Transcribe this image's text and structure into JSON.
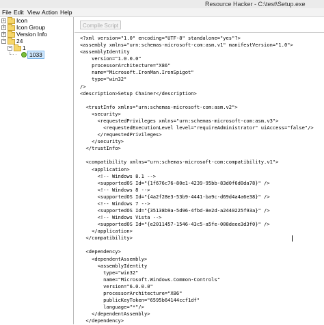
{
  "window": {
    "title": "Resource Hacker  -  C:\\test\\Setup.exe"
  },
  "menu": [
    "File",
    "Edit",
    "View",
    "Action",
    "Help"
  ],
  "tree": {
    "items": [
      {
        "label": "Icon",
        "expander": "+"
      },
      {
        "label": "Icon Group",
        "expander": "+"
      },
      {
        "label": "Version Info",
        "expander": "+"
      },
      {
        "label": "24",
        "expander": "−"
      },
      {
        "label": "1",
        "expander": "−"
      },
      {
        "label": "1033",
        "expander": ""
      }
    ]
  },
  "toolbar": {
    "compile_label": "Compile Script"
  },
  "editor": {
    "lines": [
      "<?xml version=\"1.0\" encoding=\"UTF-8\" standalone=\"yes\"?>",
      "<assembly xmlns=\"urn:schemas-microsoft-com:asm.v1\" manifestVersion=\"1.0\">",
      "<assemblyIdentity",
      "    version=\"1.0.0.0\"",
      "    processorArchitecture=\"X86\"",
      "    name=\"Microsoft.IronMan.IronSpigot\"",
      "    type=\"win32\"",
      "/>",
      "<description>Setup Chainer</description>",
      "",
      "  <trustInfo xmlns=\"urn:schemas-microsoft-com:asm.v2\">",
      "    <security>",
      "      <requestedPrivileges xmlns=\"urn:schemas-microsoft-com:asm.v3\">",
      "        <requestedExecutionLevel level=\"requireAdministrator\" uiAccess=\"false\"/>",
      "      </requestedPrivileges>",
      "    </security>",
      "  </trustInfo>",
      "",
      "  <compatibility xmlns=\"urn:schemas-microsoft-com:compatibility.v1\">",
      "    <application>",
      "      <!-- Windows 8.1 -->",
      "      <supportedOS Id=\"{1f676c76-80e1-4239-95bb-83d0f6d0da78}\" />",
      "      <!-- Windows 8 -->",
      "      <supportedOS Id=\"{4a2f28e3-53b9-4441-ba9c-d69d4a4a6e38}\" />",
      "      <!-- Windows 7 -->",
      "      <supportedOS Id=\"{35138b9a-5d96-4fbd-8e2d-a2440225f93a}\" />",
      "      <!-- Windows Vista -->",
      "      <supportedOS Id=\"{e2011457-1546-43c5-a5fe-008deee3d3f0}\" />",
      "    </application>",
      "  </compatibility>",
      "",
      "  <dependency>",
      "    <dependentAssembly>",
      "      <assemblyIdentity",
      "        type=\"win32\"",
      "        name=\"Microsoft.Windows.Common-Controls\"",
      "        version=\"6.0.0.0\"",
      "        processorArchitecture=\"X86\"",
      "        publicKeyToken=\"6595b64144ccf1df\"",
      "        language=\"*\"/>",
      "    </dependentAssembly>",
      "  </dependency>",
      "</assembly>"
    ]
  }
}
